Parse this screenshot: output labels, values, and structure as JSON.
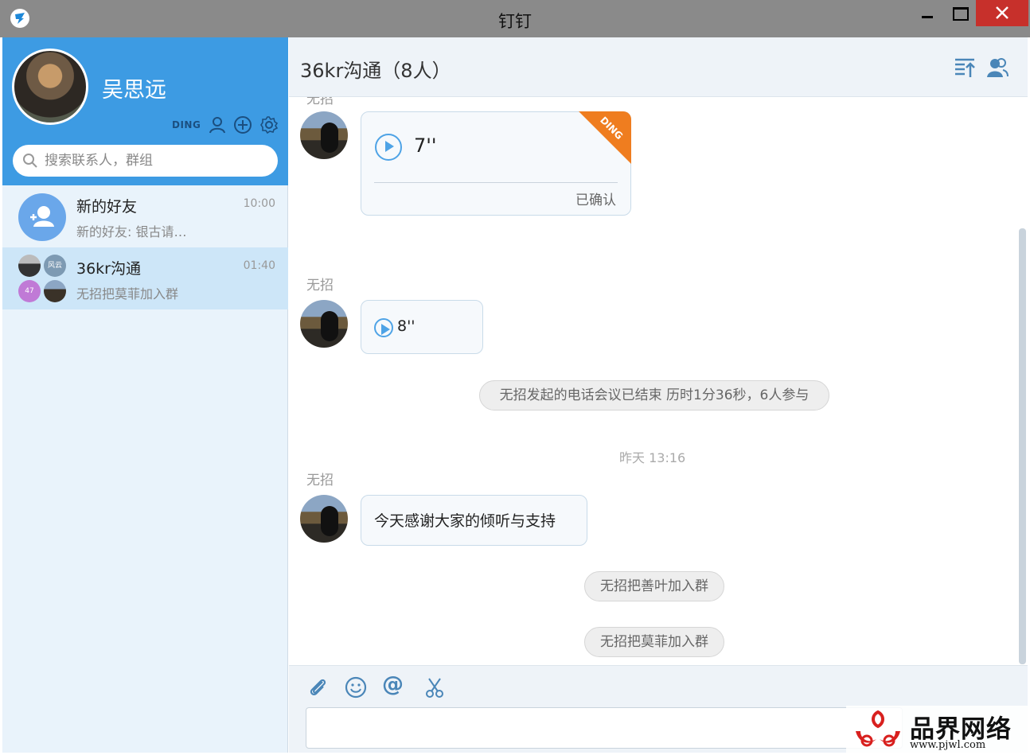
{
  "window": {
    "title": "钉钉"
  },
  "profile": {
    "name": "吴思远",
    "ding_label": "DING"
  },
  "search": {
    "placeholder": "搜索联系人，群组"
  },
  "conversations": [
    {
      "name": "新的好友",
      "time": "10:00",
      "preview": "新的好友: 银古请…",
      "avatar_color": "#6aa7ea"
    },
    {
      "name": "36kr沟通",
      "time": "01:40",
      "preview": "无招把莫菲加入群",
      "group_avatars": [
        "",
        "风云",
        "47",
        ""
      ]
    }
  ],
  "chat": {
    "title": "36kr沟通（8人）",
    "messages": {
      "top_partial_sender": "无招",
      "voice1": {
        "duration": "7''",
        "ding_badge": "DING",
        "status": "已确认"
      },
      "voice2_sender": "无招",
      "voice2": {
        "duration": "8''"
      },
      "system1": "无招发起的电话会议已结束 历时1分36秒，6人参与",
      "timestamp": "昨天 13:16",
      "text_sender": "无招",
      "text": "今天感谢大家的倾听与支持",
      "system2": "无招把善叶加入群",
      "system3": "无招把莫菲加入群"
    }
  },
  "composer": {
    "placeholder": ""
  },
  "watermark": {
    "brand": "品界网络",
    "url": "www.pjwl.com"
  },
  "colors": {
    "accent": "#3d9be3",
    "ding_orange": "#ef7d1f",
    "close_red": "#c7302b"
  }
}
